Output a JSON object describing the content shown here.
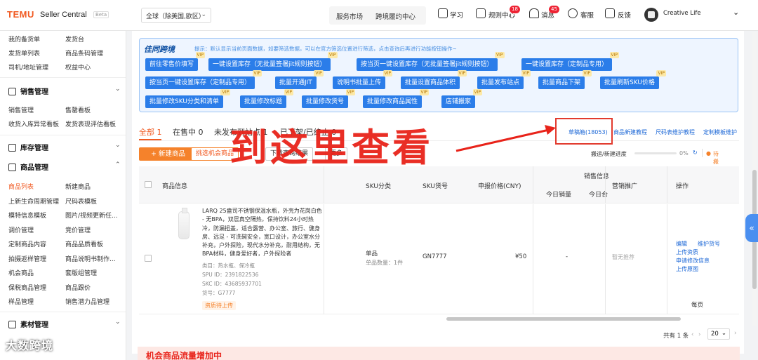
{
  "topbar": {
    "logo": "TEMU",
    "title": "Seller Central",
    "beta": "Beta",
    "region": "全球（除美国,欧区）",
    "service_market": "服务市场",
    "cross_border": "跨境履约中心",
    "learn": "学习",
    "rules": "规则中心",
    "rules_badge": "18",
    "messages": "消息",
    "messages_badge": "45",
    "support": "客服",
    "feedback": "反馈",
    "user": "Creative Life"
  },
  "sidebar": {
    "top_items": [
      "我的备货单",
      "发货台",
      "发货单列表",
      "商品条码管理",
      "司机/地址管理",
      "权益中心"
    ],
    "sales_section": "销售管理",
    "sales_items": [
      "销售管理",
      "售罄看板",
      "收货入库异常看板",
      "发货表现评估看板"
    ],
    "stock_section": "库存管理",
    "goods_section": "商品管理",
    "goods_items": [
      "商品列表",
      "新建商品",
      "上新生命周期管理",
      "尺码表模板",
      "模特信息模板",
      "图片/视频更新任...",
      "调价管理",
      "竞价管理",
      "定制商品内容",
      "商品品质看板",
      "拍摄返样管理",
      "商品说明书制作...",
      "机会商品",
      "套版组管理",
      "保税商品管理",
      "商品跟价",
      "样品管理",
      "销售潜力品管理"
    ],
    "material_section": "素材管理"
  },
  "plugin": {
    "logo": "佳同跨境",
    "tip": "提示：默认显示当前页面数据，如要筛选数据，可以在官方筛选位置进行筛选，点击查询后再进行功能按钮操作~",
    "vip": "VIP",
    "row1": [
      "前往零售价填写",
      "一键设置库存（无批量签署jit规则按钮）",
      "按当页一键设置库存（无批量签署jit规则按钮）",
      "一键设置库存（定制品专用）"
    ],
    "row2": [
      "按当页一键设置库存（定制品专用）",
      "批量开通JIT",
      "说明书批量上传",
      "批量设置商品体积",
      "批量发布站点",
      "批量商品下架",
      "批量刷新SKU价格"
    ],
    "row3": [
      "批量修改SKU分类和清单",
      "批量修改标题",
      "批量修改货号",
      "批量修改商品属性",
      "店铺搬家"
    ]
  },
  "tabs": {
    "all": "全部 1",
    "on_sale": "在售中 0",
    "not_published": "未发布到站点 1",
    "off_shelf": "已下架/已终止 0"
  },
  "links": {
    "draft": "草稿箱(18053)",
    "new_goods_tutorial": "商品新建教程",
    "size_chart_tutorial": "尺码表维护教程",
    "custom_template": "定制模板维护"
  },
  "toolbar": {
    "new_goods": "+ 新建商品",
    "pick_opportunity": "挑选机会商品",
    "download_result": "下载查询结果",
    "more": "更多"
  },
  "progress": {
    "label": "搬运/新建进度",
    "percent": "0%",
    "pending": "待搬运0"
  },
  "annotation": {
    "big_text": "到这里查看"
  },
  "table": {
    "headers": {
      "product_info": "商品信息",
      "sku_category": "SKU分类",
      "sku_code": "SKU货号",
      "declared_price": "申报价格(CNY)",
      "sales_info": "销售信息",
      "today_sales": "今日销量",
      "today_sales_2": "今日合",
      "marketing": "营销推广",
      "operations": "操作"
    },
    "row": {
      "description": "LARQ 25盎司不锈钢保温水瓶，外壳为花岗白色 - 无BPA，双层真空隔热，保持饮料24小时热冷，防漏扭盖，适合露营、办公室、旅行、健身房、远足 - 可洗碗安全，宽口设计，办公室水分补充，户外探险，现代水分补充，耐用结构，无BPA材料，健身爱好者，户外探险者",
      "category": "类目：热水瓶、保冷瓶",
      "spu": "SPU ID：2391822536",
      "skc": "SKC ID：43685937701",
      "sku_code_label": "货号：G7777",
      "status_tag": "资质待上传",
      "sku_type": "单品",
      "sku_qty": "单品数量：1件",
      "sku_code": "GN7777",
      "price": "¥50",
      "today_sales": "-",
      "marketing": "暂无推荐",
      "ops": [
        "编辑",
        "维护货号",
        "上传资质",
        "申请修改信息",
        "上传原图"
      ]
    }
  },
  "pagination": {
    "total": "共有 1 条",
    "per_page_label": "每页",
    "per_page": "20"
  },
  "banner": {
    "text": "机会商品流量增加中"
  },
  "watermark": "大数跨境"
}
